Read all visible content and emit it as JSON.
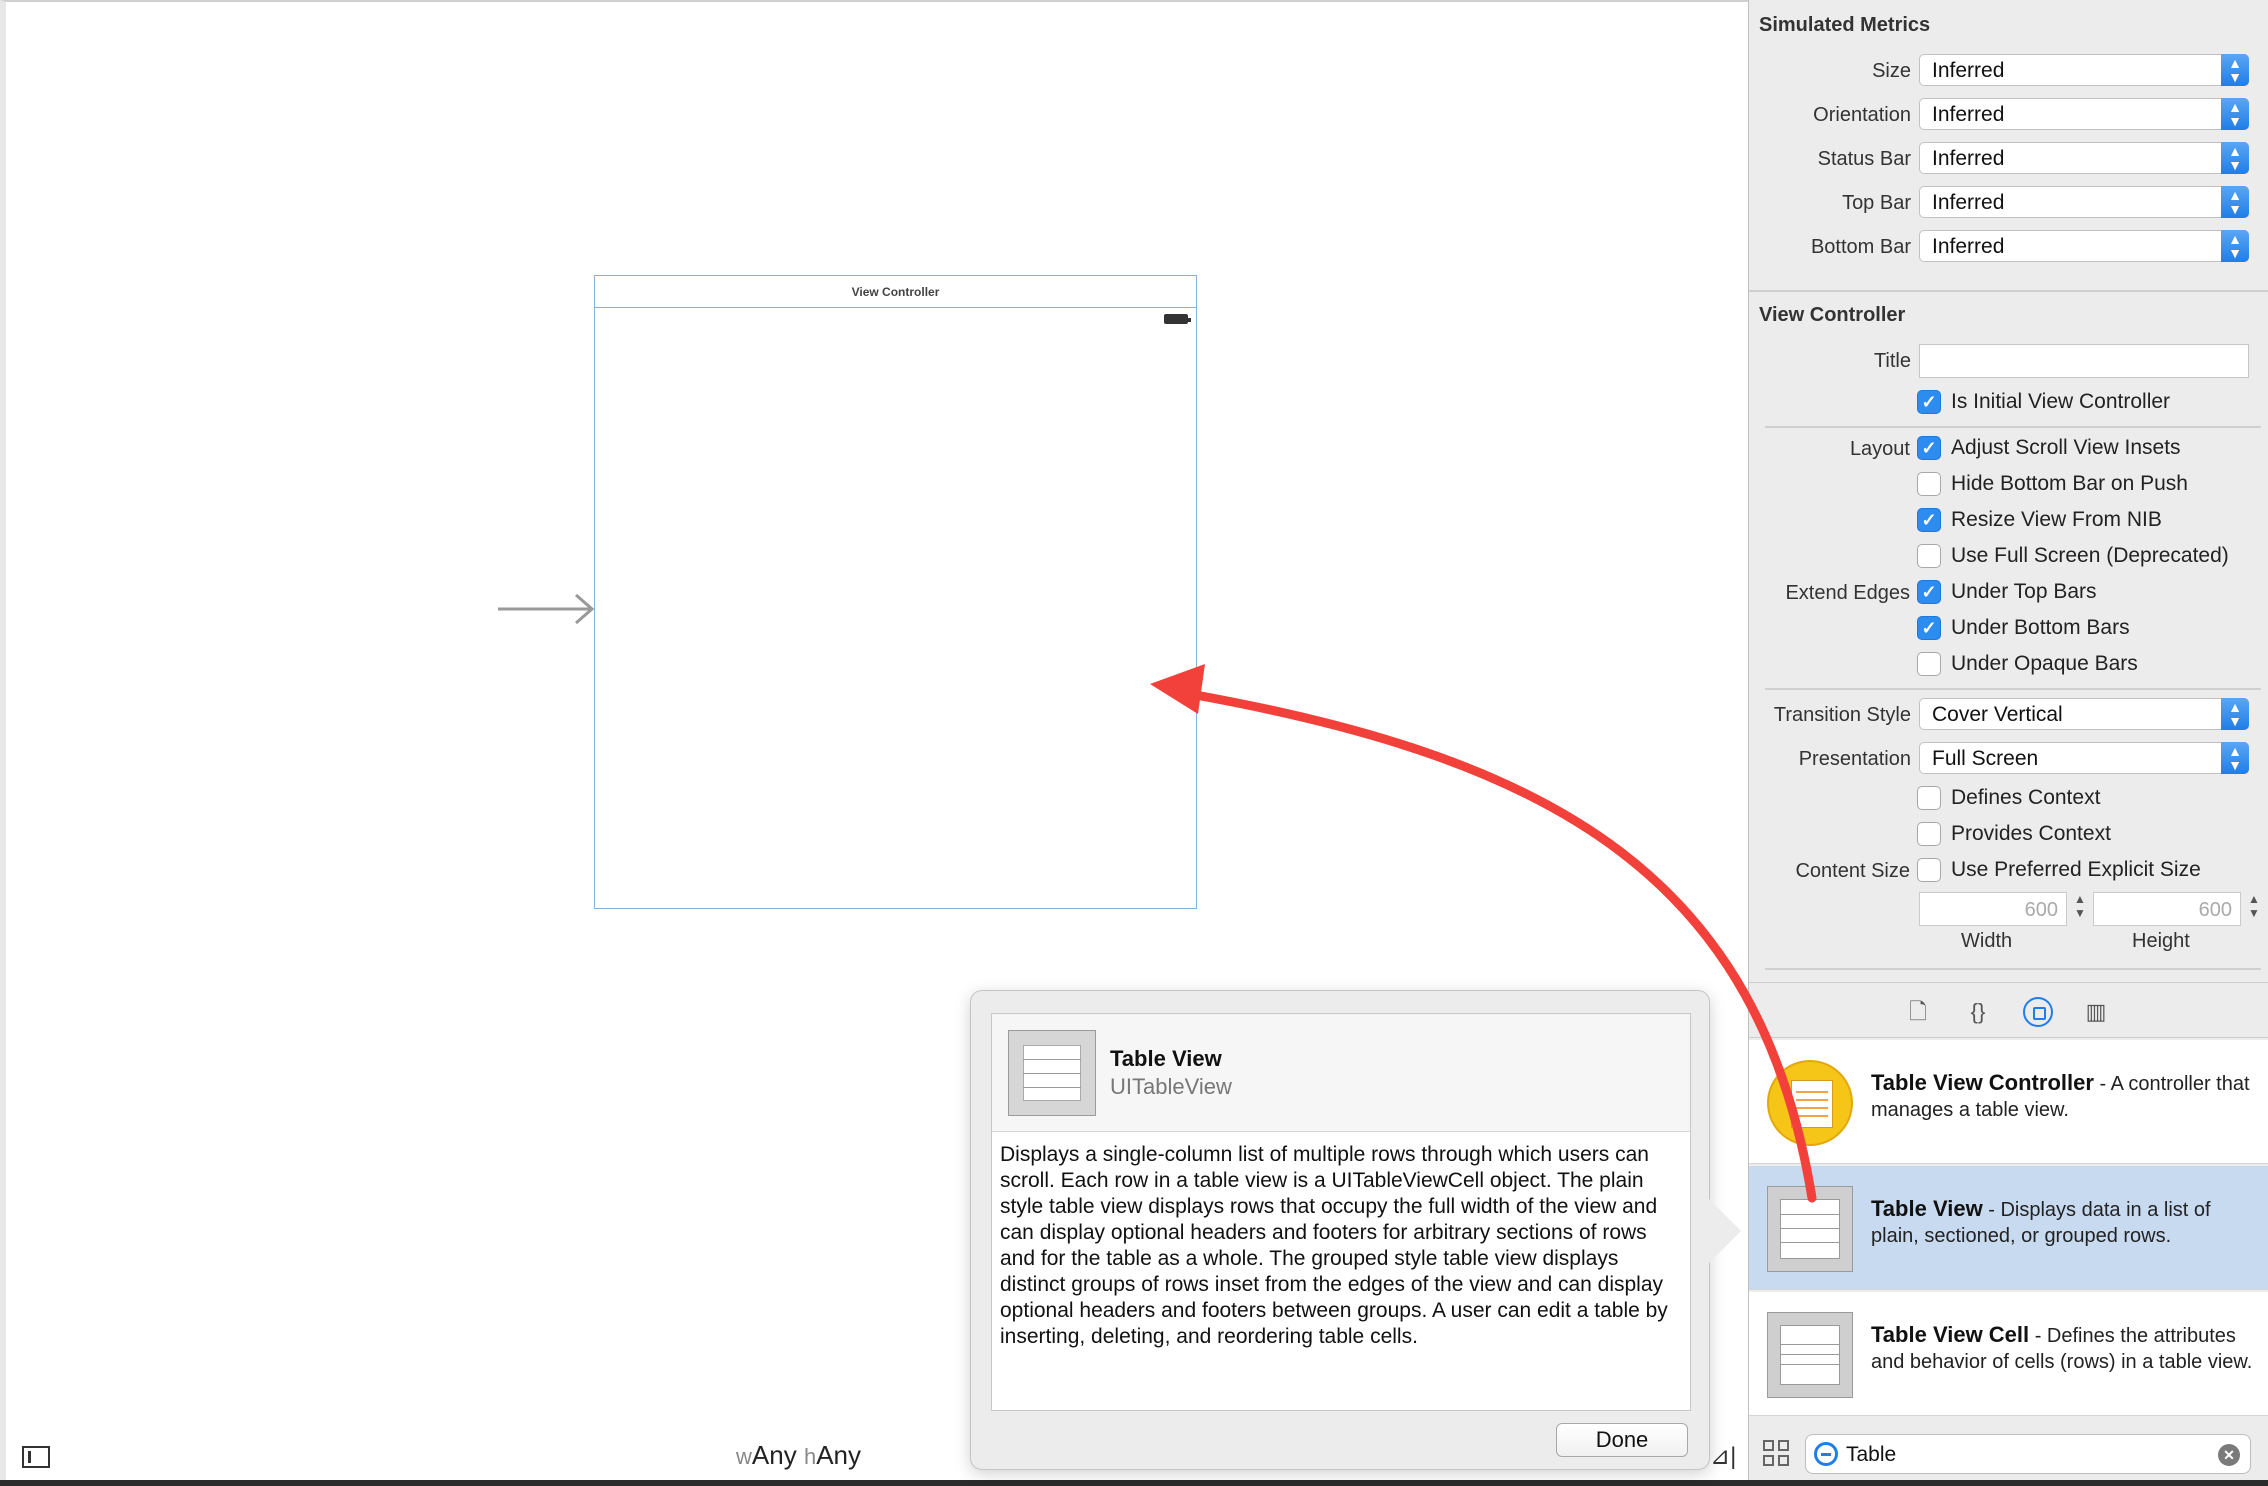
{
  "canvas": {
    "scene_title": "View Controller",
    "size_class_w_prefix": "w",
    "size_class_w": "Any",
    "size_class_h_prefix": "h",
    "size_class_h": "Any",
    "resolve_icon": "⊿|"
  },
  "popover": {
    "title": "Table View",
    "class_name": "UITableView",
    "description": "Displays a single-column list of multiple rows through which users can scroll. Each row in a table view is a UITableViewCell object. The plain style table view displays rows that occupy the full width of the view and can display optional headers and footers for arbitrary sections of rows and for the table as a whole. The grouped style table view displays distinct groups of rows inset from the edges of the view and can display optional headers and footers between groups. A user can edit a table by inserting, deleting, and reordering table cells.",
    "done_label": "Done"
  },
  "inspector": {
    "simulated_metrics": {
      "title": "Simulated Metrics",
      "rows": [
        {
          "label": "Size",
          "value": "Inferred"
        },
        {
          "label": "Orientation",
          "value": "Inferred"
        },
        {
          "label": "Status Bar",
          "value": "Inferred"
        },
        {
          "label": "Top Bar",
          "value": "Inferred"
        },
        {
          "label": "Bottom Bar",
          "value": "Inferred"
        }
      ]
    },
    "view_controller": {
      "title": "View Controller",
      "title_label": "Title",
      "title_value": "",
      "initial": {
        "label": "Is Initial View Controller",
        "checked": true
      },
      "layout_label": "Layout",
      "layout": [
        {
          "label": "Adjust Scroll View Insets",
          "checked": true
        },
        {
          "label": "Hide Bottom Bar on Push",
          "checked": false
        },
        {
          "label": "Resize View From NIB",
          "checked": true
        },
        {
          "label": "Use Full Screen (Deprecated)",
          "checked": false
        }
      ],
      "extend_label": "Extend Edges",
      "extend": [
        {
          "label": "Under Top Bars",
          "checked": true
        },
        {
          "label": "Under Bottom Bars",
          "checked": true
        },
        {
          "label": "Under Opaque Bars",
          "checked": false
        }
      ],
      "transition_label": "Transition Style",
      "transition_value": "Cover Vertical",
      "presentation_label": "Presentation",
      "presentation_value": "Full Screen",
      "defines_context": {
        "label": "Defines Context",
        "checked": false
      },
      "provides_context": {
        "label": "Provides Context",
        "checked": false
      },
      "content_size_label": "Content Size",
      "preferred_size": {
        "label": "Use Preferred Explicit Size",
        "checked": false
      },
      "width_value": "600",
      "height_value": "600",
      "width_label": "Width",
      "height_label": "Height"
    },
    "tabs": [
      "file-icon",
      "braces-icon",
      "object-icon",
      "media-icon"
    ],
    "library": [
      {
        "name": "Table View Controller",
        "desc": " - A controller that manages a table view."
      },
      {
        "name": "Table View",
        "desc": " - Displays data in a list of plain, sectioned, or grouped rows."
      },
      {
        "name": "Table View Cell",
        "desc": " - Defines the attributes and behavior of cells (rows) in a table view."
      }
    ],
    "filter_value": "Table",
    "clear_glyph": "✕"
  },
  "colors": {
    "accent": "#1f7ee8",
    "selection": "#c8daf0",
    "annotation_arrow": "#f2403a"
  }
}
